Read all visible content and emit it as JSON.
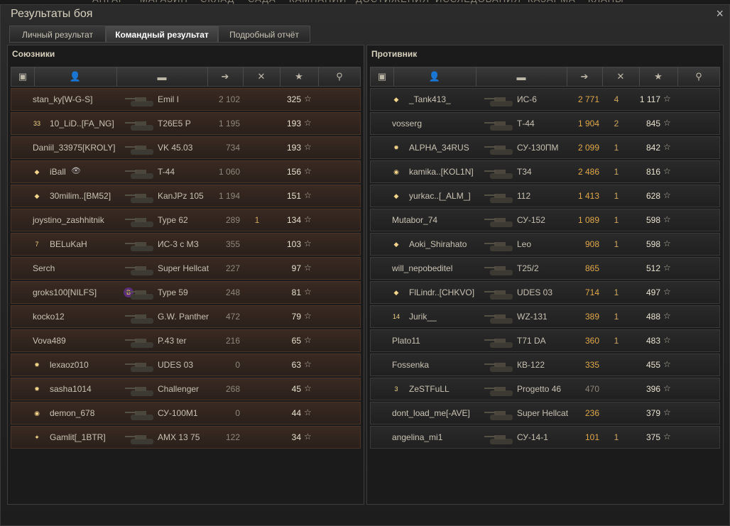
{
  "topnav": [
    "АНГАР",
    "МАГАЗИН",
    "СКЛАД",
    "САДА",
    "КАМПАНИИ",
    "ДОСТИЖЕНИЯ",
    "ИССЛЕДОВАНИЯ",
    "КАЗАРМА",
    "КЛАНЫ"
  ],
  "window": {
    "title": "Результаты боя",
    "close_icon": "×"
  },
  "tabs": [
    {
      "label": "Личный результат"
    },
    {
      "label": "Командный результат"
    },
    {
      "label": "Подробный отчёт"
    }
  ],
  "allies": {
    "title": "Союзники",
    "players": [
      {
        "name": "stan_ky[W-G-S]",
        "vehicle": "Emil I",
        "damage": "2 102",
        "kills": "",
        "xp": "325",
        "badge": "",
        "hl": true
      },
      {
        "name": "10_LiD..[FA_NG]",
        "vehicle": "T26E5 P",
        "damage": "1 195",
        "kills": "",
        "xp": "193",
        "badge": "33",
        "hl": true
      },
      {
        "name": "Daniil_33975[KROLY]",
        "vehicle": "VK 45.03",
        "damage": "734",
        "kills": "",
        "xp": "193",
        "badge": "",
        "hl": true
      },
      {
        "name": "iBall",
        "vehicle": "T-44",
        "damage": "1 060",
        "kills": "",
        "xp": "156",
        "badge": "◆",
        "hl": true,
        "self": true
      },
      {
        "name": "30milim..[BM52]",
        "vehicle": "KanJPz 105",
        "damage": "1 194",
        "kills": "",
        "xp": "151",
        "badge": "◆",
        "hl": true
      },
      {
        "name": "joystino_zashhitnik",
        "vehicle": "Type 62",
        "damage": "289",
        "kills": "1",
        "xp": "134",
        "badge": "",
        "hl": true
      },
      {
        "name": "BELuKaH",
        "vehicle": "ИС-3 с МЗ",
        "damage": "355",
        "kills": "",
        "xp": "103",
        "badge": "7",
        "hl": true
      },
      {
        "name": "Serch",
        "vehicle": "Super Hellcat",
        "damage": "227",
        "kills": "",
        "xp": "97",
        "badge": "",
        "hl": true
      },
      {
        "name": "groks100[NILFS]",
        "vehicle": "Type 59",
        "damage": "248",
        "kills": "",
        "xp": "81",
        "badge": "",
        "hl": true,
        "clan_badge": "B"
      },
      {
        "name": "kocko12",
        "vehicle": "G.W. Panther",
        "damage": "472",
        "kills": "",
        "xp": "79",
        "badge": "",
        "hl": true
      },
      {
        "name": "Vova489",
        "vehicle": "P.43 ter",
        "damage": "216",
        "kills": "",
        "xp": "65",
        "badge": "",
        "hl": true
      },
      {
        "name": "lexaoz010",
        "vehicle": "UDES 03",
        "damage": "0",
        "kills": "",
        "xp": "63",
        "badge": "✹",
        "hl": true
      },
      {
        "name": "sasha1014",
        "vehicle": "Challenger",
        "damage": "268",
        "kills": "",
        "xp": "45",
        "badge": "✹",
        "hl": true
      },
      {
        "name": "demon_678",
        "vehicle": "СУ-100М1",
        "damage": "0",
        "kills": "",
        "xp": "44",
        "badge": "◉",
        "hl": true
      },
      {
        "name": "Gamlit[_1BTR]",
        "vehicle": "AMX 13 75",
        "damage": "122",
        "kills": "",
        "xp": "34",
        "badge": "✦",
        "hl": true
      }
    ]
  },
  "enemies": {
    "title": "Противник",
    "players": [
      {
        "name": "_Tank413_",
        "vehicle": "ИС-6",
        "damage": "2 771",
        "kills": "4",
        "xp": "1 117",
        "badge": "◆"
      },
      {
        "name": "vosserg",
        "vehicle": "Т-44",
        "damage": "1 904",
        "kills": "2",
        "xp": "845",
        "badge": ""
      },
      {
        "name": "ALPHA_34RUS",
        "vehicle": "СУ-130ПМ",
        "damage": "2 099",
        "kills": "1",
        "xp": "842",
        "badge": "✹"
      },
      {
        "name": "kamika..[KOL1N]",
        "vehicle": "T34",
        "damage": "2 486",
        "kills": "1",
        "xp": "816",
        "badge": "◉"
      },
      {
        "name": "yurkac..[_ALM_]",
        "vehicle": "112",
        "damage": "1 413",
        "kills": "1",
        "xp": "628",
        "badge": "◆"
      },
      {
        "name": "Mutabor_74",
        "vehicle": "СУ-152",
        "damage": "1 089",
        "kills": "1",
        "xp": "598",
        "badge": ""
      },
      {
        "name": "Aoki_Shirahato",
        "vehicle": "Leo",
        "damage": "908",
        "kills": "1",
        "xp": "598",
        "badge": "◆"
      },
      {
        "name": "will_nepobeditel",
        "vehicle": "T25/2",
        "damage": "865",
        "kills": "",
        "xp": "512",
        "badge": ""
      },
      {
        "name": "FlLindr..[CHKVO]",
        "vehicle": "UDES 03",
        "damage": "714",
        "kills": "1",
        "xp": "497",
        "badge": "◆"
      },
      {
        "name": "Jurik__",
        "vehicle": "WZ-131",
        "damage": "389",
        "kills": "1",
        "xp": "488",
        "badge": "14"
      },
      {
        "name": "Plato11",
        "vehicle": "T71 DA",
        "damage": "360",
        "kills": "1",
        "xp": "483",
        "badge": ""
      },
      {
        "name": "Fossenka",
        "vehicle": "КВ-122",
        "damage": "335",
        "kills": "",
        "xp": "455",
        "badge": ""
      },
      {
        "name": "ZeSTFuLL",
        "vehicle": "Progetto 46",
        "damage": "470",
        "kills": "",
        "xp": "396",
        "badge": "3",
        "dead": true
      },
      {
        "name": "dont_load_me[-AVE]",
        "vehicle": "Super Hellcat",
        "damage": "236",
        "kills": "",
        "xp": "379",
        "badge": ""
      },
      {
        "name": "angelina_mi1",
        "vehicle": "СУ-14-1",
        "damage": "101",
        "kills": "1",
        "xp": "375",
        "badge": ""
      }
    ]
  },
  "icons": {
    "star": "☆",
    "eye": "👁"
  },
  "colors": {
    "gold": "#e0a84a",
    "ally_row": "#2c2a28",
    "enemy_row": "#2a2a2a"
  }
}
